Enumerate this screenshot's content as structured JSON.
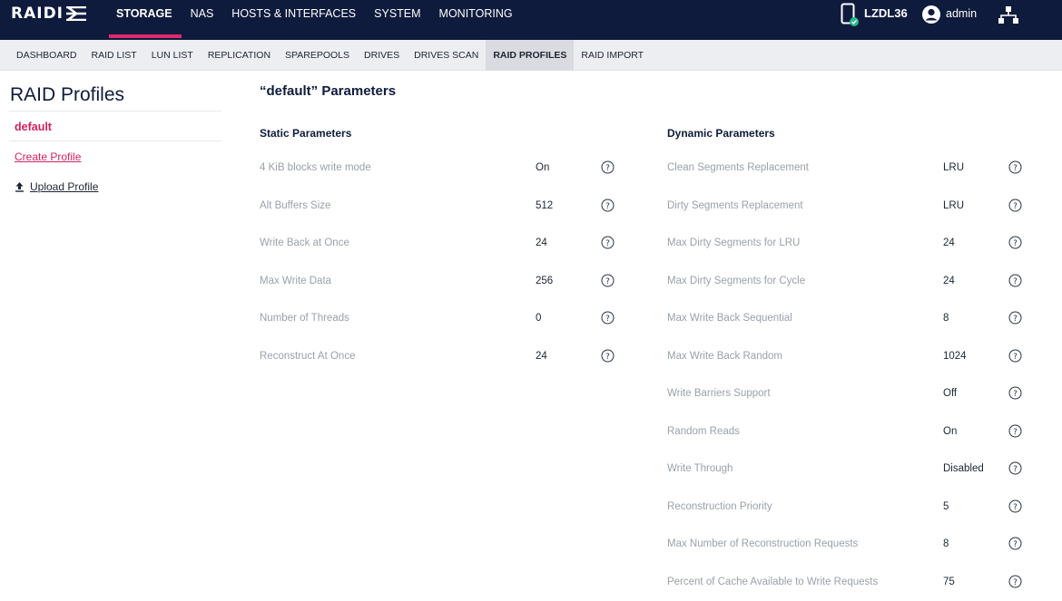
{
  "brand": {
    "logo_text": "RAIDI",
    "logo_icon": "raidix-logo-icon"
  },
  "topnav": [
    {
      "label": "STORAGE",
      "active": true
    },
    {
      "label": "NAS",
      "active": false
    },
    {
      "label": "HOSTS & INTERFACES",
      "active": false
    },
    {
      "label": "SYSTEM",
      "active": false
    },
    {
      "label": "MONITORING",
      "active": false
    }
  ],
  "top_right": {
    "device_name": "LZDL36",
    "device_icon": "server-status-icon",
    "user_name": "admin",
    "user_icon": "user-avatar-icon",
    "network_icon": "network-icon"
  },
  "subnav": [
    {
      "label": "DASHBOARD",
      "active": false
    },
    {
      "label": "RAID LIST",
      "active": false
    },
    {
      "label": "LUN LIST",
      "active": false
    },
    {
      "label": "REPLICATION",
      "active": false
    },
    {
      "label": "SPAREPOOLS",
      "active": false
    },
    {
      "label": "DRIVES",
      "active": false
    },
    {
      "label": "DRIVES SCAN",
      "active": false
    },
    {
      "label": "RAID PROFILES",
      "active": true
    },
    {
      "label": "RAID IMPORT",
      "active": false
    }
  ],
  "sidebar": {
    "title": "RAID Profiles",
    "selected_profile": "default",
    "create_label": "Create Profile",
    "upload_label": "Upload Profile"
  },
  "main": {
    "title": "“default” Parameters",
    "static": {
      "title": "Static Parameters",
      "rows": [
        {
          "label": "4 KiB blocks write mode",
          "value": "On"
        },
        {
          "label": "Alt Buffers Size",
          "value": "512"
        },
        {
          "label": "Write Back at Once",
          "value": "24"
        },
        {
          "label": "Max Write Data",
          "value": "256"
        },
        {
          "label": "Number of Threads",
          "value": "0"
        },
        {
          "label": "Reconstruct At Once",
          "value": "24"
        }
      ]
    },
    "dynamic": {
      "title": "Dynamic Parameters",
      "rows": [
        {
          "label": "Clean Segments Replacement",
          "value": "LRU"
        },
        {
          "label": "Dirty Segments Replacement",
          "value": "LRU"
        },
        {
          "label": "Max Dirty Segments for LRU",
          "value": "24"
        },
        {
          "label": "Max Dirty Segments for Cycle",
          "value": "24"
        },
        {
          "label": "Max Write Back Sequential",
          "value": "8"
        },
        {
          "label": "Max Write Back Random",
          "value": "1024"
        },
        {
          "label": "Write Barriers Support",
          "value": "Off"
        },
        {
          "label": "Random Reads",
          "value": "On"
        },
        {
          "label": "Write Through",
          "value": "Disabled"
        },
        {
          "label": "Reconstruction Priority",
          "value": "5"
        },
        {
          "label": "Max Number of Reconstruction Requests",
          "value": "8"
        },
        {
          "label": "Percent of Cache Available to Write Requests",
          "value": "75"
        }
      ]
    }
  },
  "colors": {
    "nav_bg": "#0f1b3d",
    "accent": "#e0296b",
    "link": "#d6205f",
    "subnav_bg": "#eceef1"
  }
}
